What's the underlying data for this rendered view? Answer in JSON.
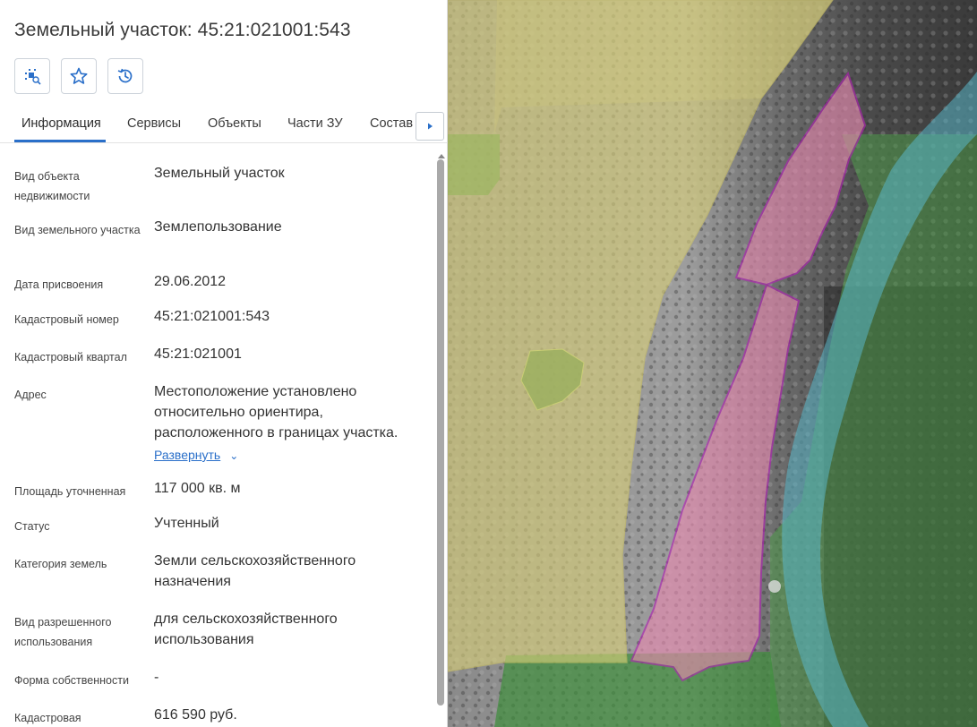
{
  "header": {
    "top_cut_text": "",
    "title": "Земельный участок: 45:21:021001:543"
  },
  "toolbar": {
    "buttons": [
      {
        "icon": "search-on-map-icon"
      },
      {
        "icon": "star-icon"
      },
      {
        "icon": "history-icon"
      }
    ]
  },
  "tabs": [
    {
      "label": "Информация",
      "active": true
    },
    {
      "label": "Сервисы"
    },
    {
      "label": "Объекты"
    },
    {
      "label": "Части ЗУ"
    },
    {
      "label": "Состав"
    }
  ],
  "rows": [
    {
      "label": "Вид объекта недвижимости",
      "value": "Земельный участок"
    },
    {
      "label": "Вид земельного участка",
      "value": "Землепользование"
    },
    {
      "label": "Дата присвоения",
      "value": "29.06.2012"
    },
    {
      "label": "Кадастровый номер",
      "value": "45:21:021001:543"
    },
    {
      "label": "Кадастровый квартал",
      "value": "45:21:021001"
    },
    {
      "label": "Адрес",
      "value": "Местоположение установлено относительно ориентира, расположенного в границах участка."
    },
    {
      "label": "Площадь уточненная",
      "value": "117 000 кв. м"
    },
    {
      "label": "Статус",
      "value": "Учтенный"
    },
    {
      "label": "Категория земель",
      "value": "Земли сельскохозяйственного назначения"
    },
    {
      "label": "Вид разрешенного использования",
      "value": "для сельскохозяйственного использования"
    },
    {
      "label": "Форма собственности",
      "value": "-"
    },
    {
      "label": "Кадастровая",
      "value": "616 590 руб."
    }
  ],
  "address_expand_label": "Развернуть",
  "colors": {
    "accent": "#2a6fc9",
    "parcel_selected": "#e070d0",
    "parcel_yellow": "#d9d07a",
    "zone_green": "#4e9a4a",
    "water_blue": "#5ab7c9"
  }
}
